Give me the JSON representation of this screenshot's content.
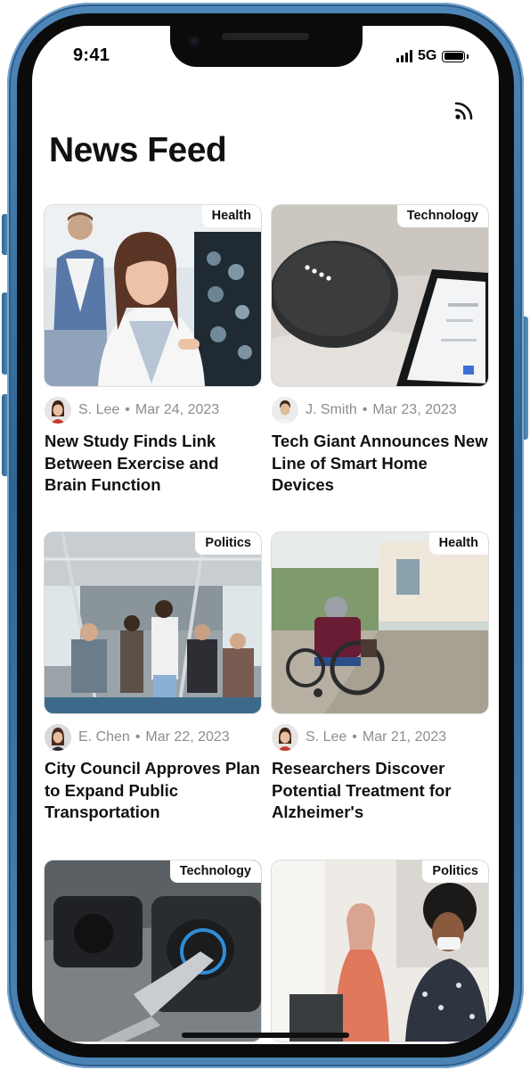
{
  "status_bar": {
    "time": "9:41",
    "network": "5G"
  },
  "header": {
    "title": "News Feed",
    "rss_icon": "rss-feed-icon"
  },
  "articles": [
    {
      "category": "Health",
      "author": "S. Lee",
      "date": "Mar 24, 2023",
      "title": "New Study Finds Link Between Exercise and Brain Function"
    },
    {
      "category": "Technology",
      "author": "J. Smith",
      "date": "Mar 23, 2023",
      "title": "Tech Giant Announces New Line of Smart Home Devices"
    },
    {
      "category": "Politics",
      "author": "E. Chen",
      "date": "Mar 22, 2023",
      "title": "City Council Approves Plan to Expand Public Transportation"
    },
    {
      "category": "Health",
      "author": "S. Lee",
      "date": "Mar 21, 2023",
      "title": "Researchers Discover Potential Treatment for Alzheimer's"
    },
    {
      "category": "Technology"
    },
    {
      "category": "Politics"
    }
  ],
  "colors": {
    "frame": "#3a6f9e",
    "text_primary": "#111111",
    "text_secondary": "#8d8d8d",
    "badge_background": "#ffffff"
  }
}
